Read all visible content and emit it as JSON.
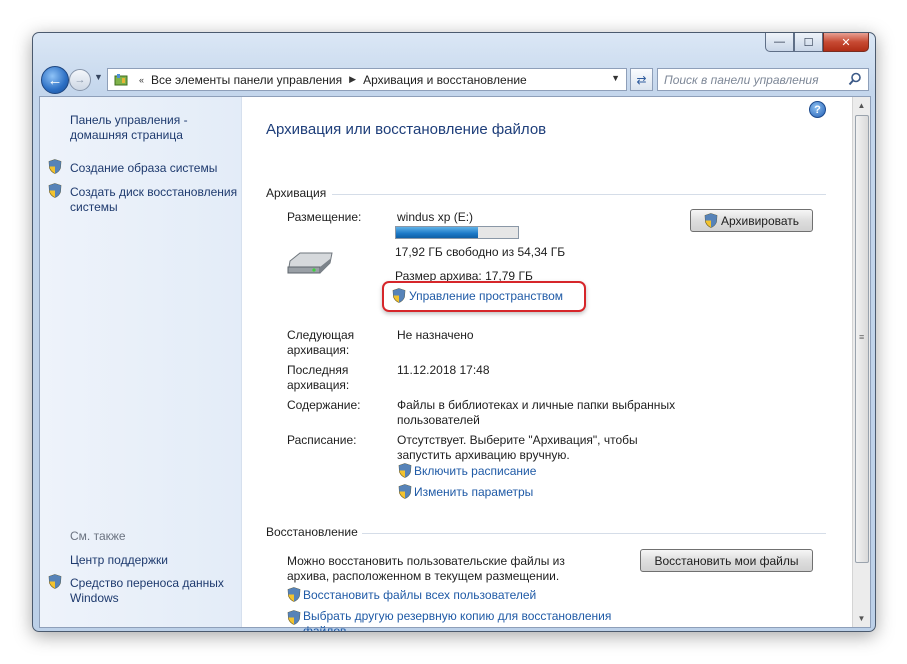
{
  "window": {
    "caption": {
      "minimize": "—",
      "maximize": "☐",
      "close": "✕"
    }
  },
  "address": {
    "breadcrumbs": [
      "Все элементы панели управления",
      "Архивация и восстановление"
    ],
    "search_placeholder": "Поиск в панели управления"
  },
  "sidebar": {
    "home_link": "Панель управления - домашняя страница",
    "tasks": [
      {
        "label": "Создание образа системы"
      },
      {
        "label": "Создать диск восстановления системы"
      }
    ],
    "see_also_label": "См. также",
    "see_also": [
      {
        "label": "Центр поддержки"
      },
      {
        "label": "Средство переноса данных Windows"
      }
    ]
  },
  "main": {
    "title": "Архивация или восстановление файлов",
    "backup": {
      "header": "Архивация",
      "location_label": "Размещение:",
      "location_value": "windus xp (E:)",
      "free_space": "17,92 ГБ свободно из 54,34 ГБ",
      "used_fraction": 0.67,
      "backup_size": "Размер архива: 17,79 ГБ",
      "manage_space_link": "Управление пространством",
      "backup_button": "Архивировать",
      "next_label": "Следующая архивация:",
      "next_value": "Не назначено",
      "last_label": "Последняя архивация:",
      "last_value": "11.12.2018 17:48",
      "contents_label": "Содержание:",
      "contents_value": "Файлы в библиотеках и личные папки выбранных пользователей",
      "schedule_label": "Расписание:",
      "schedule_value": "Отсутствует. Выберите \"Архивация\", чтобы запустить архивацию вручную.",
      "enable_schedule_link": "Включить расписание",
      "change_settings_link": "Изменить параметры"
    },
    "restore": {
      "header": "Восстановление",
      "description": "Можно восстановить пользовательские файлы из архива, расположенном в текущем размещении.",
      "restore_button": "Восстановить мои файлы",
      "restore_all_link": "Восстановить файлы всех пользователей",
      "select_other_link": "Выбрать другую резервную копию для восстановления файлов"
    }
  },
  "colors": {
    "link": "#1f5aa6",
    "title": "#1e3e7a",
    "highlight_border": "#d6262a",
    "progress_fill": "#1b78c6"
  }
}
